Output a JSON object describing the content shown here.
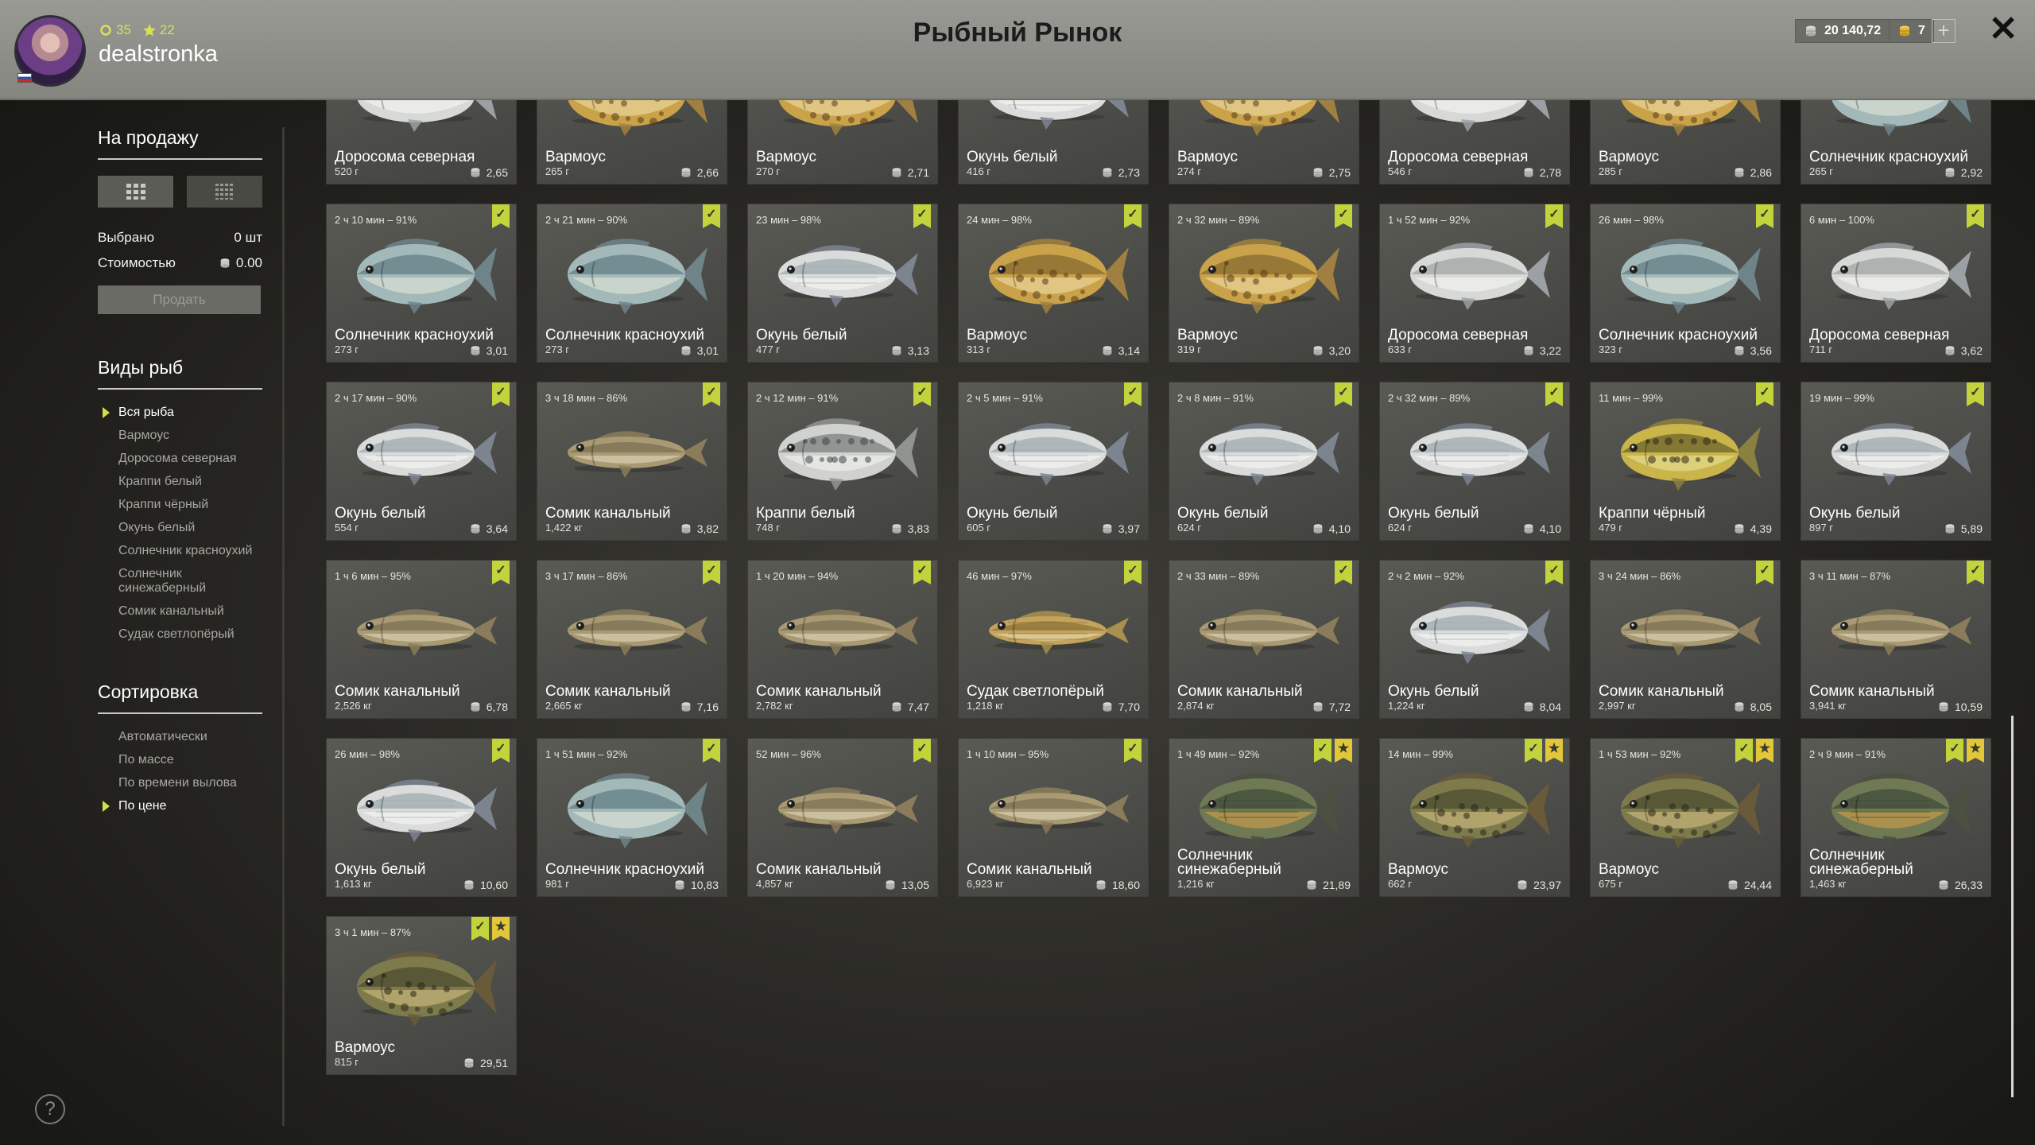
{
  "header": {
    "title": "Рыбный Рынок",
    "username": "dealstronka",
    "level": "35",
    "stars": "22",
    "silver": "20 140,72",
    "gold": "7",
    "plus": "+",
    "close": "✕"
  },
  "sidebar": {
    "for_sale_title": "На продажу",
    "selected_label": "Выбрано",
    "selected_value": "0 шт",
    "cost_label": "Стоимостью",
    "cost_value": "0.00",
    "sell_button": "Продать",
    "fish_types_title": "Виды рыб",
    "fish_types": [
      {
        "label": "Вся рыба",
        "active": true
      },
      {
        "label": "Вармоус",
        "active": false
      },
      {
        "label": "Доросома северная",
        "active": false
      },
      {
        "label": "Краппи белый",
        "active": false
      },
      {
        "label": "Краппи чёрный",
        "active": false
      },
      {
        "label": "Окунь белый",
        "active": false
      },
      {
        "label": "Солнечник красноухий",
        "active": false
      },
      {
        "label": "Солнечник синежаберный",
        "active": false
      },
      {
        "label": "Сомик канальный",
        "active": false
      },
      {
        "label": "Судак светлопёрый",
        "active": false
      }
    ],
    "sort_title": "Сортировка",
    "sort_options": [
      {
        "label": "Автоматически",
        "active": false
      },
      {
        "label": "По массе",
        "active": false
      },
      {
        "label": "По времени вылова",
        "active": false
      },
      {
        "label": "По цене",
        "active": true
      }
    ],
    "help": "?"
  },
  "colors": {
    "accent": "#d3e04a",
    "check_badge": "#c3d33c",
    "star_badge": "#e2c73a",
    "card_bg": "#4b4b47"
  },
  "cards": [
    {
      "name": "Доросома северная",
      "weight": "520 г",
      "price": "2,65",
      "meta": "",
      "species": "shad",
      "badges": []
    },
    {
      "name": "Вармоус",
      "weight": "265 г",
      "price": "2,66",
      "meta": "",
      "species": "warmouth",
      "badges": []
    },
    {
      "name": "Вармоус",
      "weight": "270 г",
      "price": "2,71",
      "meta": "",
      "species": "warmouth",
      "badges": []
    },
    {
      "name": "Окунь белый",
      "weight": "416 г",
      "price": "2,73",
      "meta": "",
      "species": "whitebass",
      "badges": []
    },
    {
      "name": "Вармоус",
      "weight": "274 г",
      "price": "2,75",
      "meta": "",
      "species": "warmouth",
      "badges": []
    },
    {
      "name": "Доросома северная",
      "weight": "546 г",
      "price": "2,78",
      "meta": "",
      "species": "shad",
      "badges": []
    },
    {
      "name": "Вармоус",
      "weight": "285 г",
      "price": "2,86",
      "meta": "",
      "species": "warmouth",
      "badges": []
    },
    {
      "name": "Солнечник красноухий",
      "weight": "265 г",
      "price": "2,92",
      "meta": "",
      "species": "redear",
      "badges": []
    },
    {
      "name": "Солнечник красноухий",
      "weight": "273 г",
      "price": "3,01",
      "meta": "2 ч 10 мин – 91%",
      "species": "redear",
      "badges": [
        "check"
      ]
    },
    {
      "name": "Солнечник красноухий",
      "weight": "273 г",
      "price": "3,01",
      "meta": "2 ч 21 мин – 90%",
      "species": "redear",
      "badges": [
        "check"
      ]
    },
    {
      "name": "Окунь белый",
      "weight": "477 г",
      "price": "3,13",
      "meta": "23 мин – 98%",
      "species": "whitebass",
      "badges": [
        "check"
      ]
    },
    {
      "name": "Вармоус",
      "weight": "313 г",
      "price": "3,14",
      "meta": "24 мин – 98%",
      "species": "warmouth",
      "badges": [
        "check"
      ]
    },
    {
      "name": "Вармоус",
      "weight": "319 г",
      "price": "3,20",
      "meta": "2 ч 32 мин – 89%",
      "species": "warmouth",
      "badges": [
        "check"
      ]
    },
    {
      "name": "Доросома северная",
      "weight": "633 г",
      "price": "3,22",
      "meta": "1 ч 52 мин – 92%",
      "species": "shad",
      "badges": [
        "check"
      ]
    },
    {
      "name": "Солнечник красноухий",
      "weight": "323 г",
      "price": "3,56",
      "meta": "26 мин – 98%",
      "species": "redear",
      "badges": [
        "check"
      ]
    },
    {
      "name": "Доросома северная",
      "weight": "711 г",
      "price": "3,62",
      "meta": "6 мин – 100%",
      "species": "shad",
      "badges": [
        "check"
      ]
    },
    {
      "name": "Окунь белый",
      "weight": "554 г",
      "price": "3,64",
      "meta": "2 ч 17 мин – 90%",
      "species": "whitebass",
      "badges": [
        "check"
      ]
    },
    {
      "name": "Сомик канальный",
      "weight": "1,422 кг",
      "price": "3,82",
      "meta": "3 ч 18 мин – 86%",
      "species": "catfish",
      "badges": [
        "check"
      ]
    },
    {
      "name": "Краппи белый",
      "weight": "748 г",
      "price": "3,83",
      "meta": "2 ч 12 мин – 91%",
      "species": "whitecrappie",
      "badges": [
        "check"
      ]
    },
    {
      "name": "Окунь белый",
      "weight": "605 г",
      "price": "3,97",
      "meta": "2 ч 5 мин – 91%",
      "species": "whitebass",
      "badges": [
        "check"
      ]
    },
    {
      "name": "Окунь белый",
      "weight": "624 г",
      "price": "4,10",
      "meta": "2 ч 8 мин – 91%",
      "species": "whitebass",
      "badges": [
        "check"
      ]
    },
    {
      "name": "Окунь белый",
      "weight": "624 г",
      "price": "4,10",
      "meta": "2 ч 32 мин – 89%",
      "species": "whitebass",
      "badges": [
        "check"
      ]
    },
    {
      "name": "Краппи чёрный",
      "weight": "479 г",
      "price": "4,39",
      "meta": "11 мин – 99%",
      "species": "blackcrappie",
      "badges": [
        "check"
      ]
    },
    {
      "name": "Окунь белый",
      "weight": "897 г",
      "price": "5,89",
      "meta": "19 мин – 99%",
      "species": "whitebass",
      "badges": [
        "check"
      ]
    },
    {
      "name": "Сомик канальный",
      "weight": "2,526 кг",
      "price": "6,78",
      "meta": "1 ч 6 мин – 95%",
      "species": "catfish",
      "badges": [
        "check"
      ]
    },
    {
      "name": "Сомик канальный",
      "weight": "2,665 кг",
      "price": "7,16",
      "meta": "3 ч 17 мин – 86%",
      "species": "catfish",
      "badges": [
        "check"
      ]
    },
    {
      "name": "Сомик канальный",
      "weight": "2,782 кг",
      "price": "7,47",
      "meta": "1 ч 20 мин – 94%",
      "species": "catfish",
      "badges": [
        "check"
      ]
    },
    {
      "name": "Судак светлопёрый",
      "weight": "1,218 кг",
      "price": "7,70",
      "meta": "46 мин – 97%",
      "species": "walleye",
      "badges": [
        "check"
      ]
    },
    {
      "name": "Сомик канальный",
      "weight": "2,874 кг",
      "price": "7,72",
      "meta": "2 ч 33 мин – 89%",
      "species": "catfish",
      "badges": [
        "check"
      ]
    },
    {
      "name": "Окунь белый",
      "weight": "1,224 кг",
      "price": "8,04",
      "meta": "2 ч 2 мин – 92%",
      "species": "whitebass",
      "badges": [
        "check"
      ]
    },
    {
      "name": "Сомик канальный",
      "weight": "2,997 кг",
      "price": "8,05",
      "meta": "3 ч 24 мин – 86%",
      "species": "catfish",
      "badges": [
        "check"
      ]
    },
    {
      "name": "Сомик канальный",
      "weight": "3,941 кг",
      "price": "10,59",
      "meta": "3 ч 11 мин – 87%",
      "species": "catfish",
      "badges": [
        "check"
      ]
    },
    {
      "name": "Окунь белый",
      "weight": "1,613 кг",
      "price": "10,60",
      "meta": "26 мин – 98%",
      "species": "whitebass",
      "badges": [
        "check"
      ]
    },
    {
      "name": "Солнечник красноухий",
      "weight": "981 г",
      "price": "10,83",
      "meta": "1 ч 51 мин – 92%",
      "species": "redear",
      "badges": [
        "check"
      ]
    },
    {
      "name": "Сомик канальный",
      "weight": "4,857 кг",
      "price": "13,05",
      "meta": "52 мин – 96%",
      "species": "catfish",
      "badges": [
        "check"
      ]
    },
    {
      "name": "Сомик канальный",
      "weight": "6,923 кг",
      "price": "18,60",
      "meta": "1 ч 10 мин – 95%",
      "species": "catfish",
      "badges": [
        "check"
      ]
    },
    {
      "name": "Солнечник синежаберный",
      "weight": "1,216 кг",
      "price": "21,89",
      "meta": "1 ч 49 мин – 92%",
      "species": "bluegill",
      "badges": [
        "check",
        "star"
      ]
    },
    {
      "name": "Вармоус",
      "weight": "662 г",
      "price": "23,97",
      "meta": "14 мин – 99%",
      "species": "warmouth_dark",
      "badges": [
        "check",
        "star"
      ]
    },
    {
      "name": "Вармоус",
      "weight": "675 г",
      "price": "24,44",
      "meta": "1 ч 53 мин – 92%",
      "species": "warmouth_dark",
      "badges": [
        "check",
        "star"
      ]
    },
    {
      "name": "Солнечник синежаберный",
      "weight": "1,463 кг",
      "price": "26,33",
      "meta": "2 ч 9 мин – 91%",
      "species": "bluegill",
      "badges": [
        "check",
        "star"
      ]
    },
    {
      "name": "Вармоус",
      "weight": "815 г",
      "price": "29,51",
      "meta": "3 ч 1 мин – 87%",
      "species": "warmouth_dark",
      "badges": [
        "check",
        "star"
      ]
    }
  ]
}
